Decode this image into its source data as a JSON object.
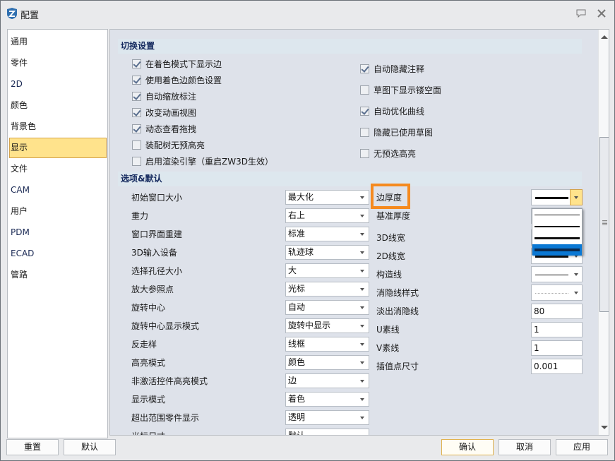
{
  "window": {
    "title": "配置"
  },
  "sidebar": {
    "selected_index": 5,
    "items": [
      {
        "label": "通用"
      },
      {
        "label": "零件"
      },
      {
        "label": "2D"
      },
      {
        "label": "颜色"
      },
      {
        "label": "背景色"
      },
      {
        "label": "显示"
      },
      {
        "label": "文件"
      },
      {
        "label": "CAM"
      },
      {
        "label": "用户"
      },
      {
        "label": "PDM"
      },
      {
        "label": "ECAD"
      },
      {
        "label": "管路"
      }
    ]
  },
  "toggle_settings": {
    "title": "切换设置",
    "left": [
      {
        "label": "在着色模式下显示边",
        "checked": true
      },
      {
        "label": "使用着色边颜色设置",
        "checked": true
      },
      {
        "label": "自动缩放标注",
        "checked": true
      },
      {
        "label": "改变动画视图",
        "checked": true
      },
      {
        "label": "动态查看拖拽",
        "checked": true
      },
      {
        "label": "装配树无预高亮",
        "checked": false
      },
      {
        "label": "启用渲染引擎（重启ZW3D生效）",
        "checked": false
      }
    ],
    "right": [
      {
        "label": "自动隐藏注释",
        "checked": true
      },
      {
        "label": "草图下显示镂空面",
        "checked": false
      },
      {
        "label": "自动优化曲线",
        "checked": true
      },
      {
        "label": "隐藏已使用草图",
        "checked": false
      },
      {
        "label": "无预选高亮",
        "checked": false
      }
    ]
  },
  "options_defaults": {
    "title": "选项&默认",
    "left": [
      {
        "label": "初始窗口大小",
        "value": "最大化"
      },
      {
        "label": "重力",
        "value": "右上"
      },
      {
        "label": "窗口界面重建",
        "value": "标准"
      },
      {
        "label": "3D输入设备",
        "value": "轨迹球"
      },
      {
        "label": "选择孔径大小",
        "value": "大"
      },
      {
        "label": "放大参照点",
        "value": "光标"
      },
      {
        "label": "旋转中心",
        "value": "自动"
      },
      {
        "label": "旋转中心显示模式",
        "value": "旋转中显示"
      },
      {
        "label": "反走样",
        "value": "线框"
      },
      {
        "label": "高亮模式",
        "value": "颜色"
      },
      {
        "label": "非激活控件高亮模式",
        "value": "边"
      },
      {
        "label": "显示模式",
        "value": "着色"
      },
      {
        "label": "超出范围零件显示",
        "value": "透明"
      },
      {
        "label": "光标尺寸",
        "value": "默认"
      }
    ],
    "right": [
      {
        "label": "边厚度",
        "type": "line-combo",
        "value": "thick",
        "highlighted": true,
        "open": true
      },
      {
        "label": "基准厚度",
        "type": "line-combo",
        "value": "thin"
      },
      {
        "label": "3D线宽",
        "type": "line-combo",
        "value": "medium"
      },
      {
        "label": "2D线宽",
        "type": "line-combo",
        "value": "thick"
      },
      {
        "label": "构造线",
        "type": "line-combo",
        "value": "thin"
      },
      {
        "label": "消隐线样式",
        "type": "line-combo",
        "value": "dotted"
      },
      {
        "label": "淡出消隐线",
        "type": "input",
        "value": "80"
      },
      {
        "label": "U素线",
        "type": "input",
        "value": "1"
      },
      {
        "label": "V素线",
        "type": "input",
        "value": "1"
      },
      {
        "label": "插值点尺寸",
        "type": "input",
        "value": "0.001"
      }
    ],
    "edge_thickness_dropdown": {
      "options": [
        "thin",
        "medium",
        "thick",
        "extra-thick"
      ],
      "selected_index": 3
    }
  },
  "buttons": {
    "reset": "重置",
    "default": "默认",
    "ok": "确认",
    "cancel": "取消",
    "apply": "应用"
  },
  "colors": {
    "accent_highlight": "#f58a1f",
    "selection": "#ffe38c",
    "dropdown_selected": "#0a78d4"
  }
}
